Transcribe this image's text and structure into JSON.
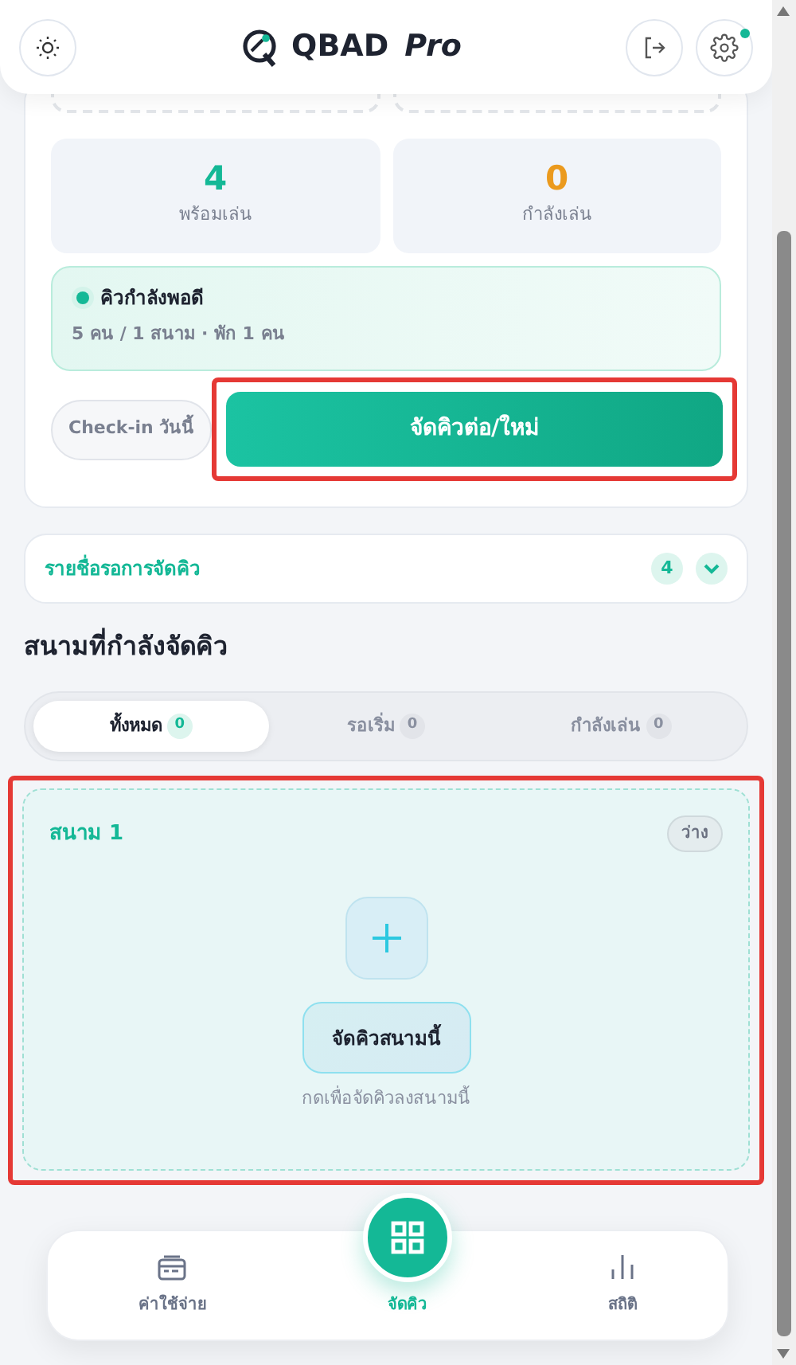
{
  "header": {
    "title": "QBAD",
    "title_suffix": "Pro",
    "settings_notice": true
  },
  "summary": {
    "stats": [
      {
        "value": "4",
        "label": "พร้อมเล่น",
        "color": "#14b896"
      },
      {
        "value": "0",
        "label": "กำลังเล่น",
        "color": "#eb9a1e"
      }
    ],
    "status": {
      "title": "คิวกำลังพอดี",
      "detail": "5 คน / 1 สนาม · พัก 1 คน"
    },
    "checkin_button": "Check-in วันนี้",
    "arrange_button": "จัดคิวต่อ/ใหม่",
    "arrange_highlighted": true
  },
  "waiting_list": {
    "title": "รายชื่อรอการจัดคิว",
    "count": "4",
    "expanded": false
  },
  "section_title": "สนามที่กำลังจัดคิว",
  "tabs": [
    {
      "label": "ทั้งหมด",
      "count": "0",
      "selected": true
    },
    {
      "label": "รอเริ่ม",
      "count": "0",
      "selected": false
    },
    {
      "label": "กำลังเล่น",
      "count": "0",
      "selected": false
    }
  ],
  "courts": [
    {
      "name": "สนาม 1",
      "status": "ว่าง",
      "button": "จัดคิวสนามนี้",
      "hint": "กดเพื่อจัดคิวลงสนามนี้",
      "highlighted": true
    }
  ],
  "bottom_nav": [
    {
      "label": "ค่าใช้จ่าย",
      "kind": "wallet",
      "selected": false
    },
    {
      "label": "จัดคิว",
      "kind": "grid",
      "selected": true
    },
    {
      "label": "สถิติ",
      "kind": "chart",
      "selected": false
    }
  ]
}
